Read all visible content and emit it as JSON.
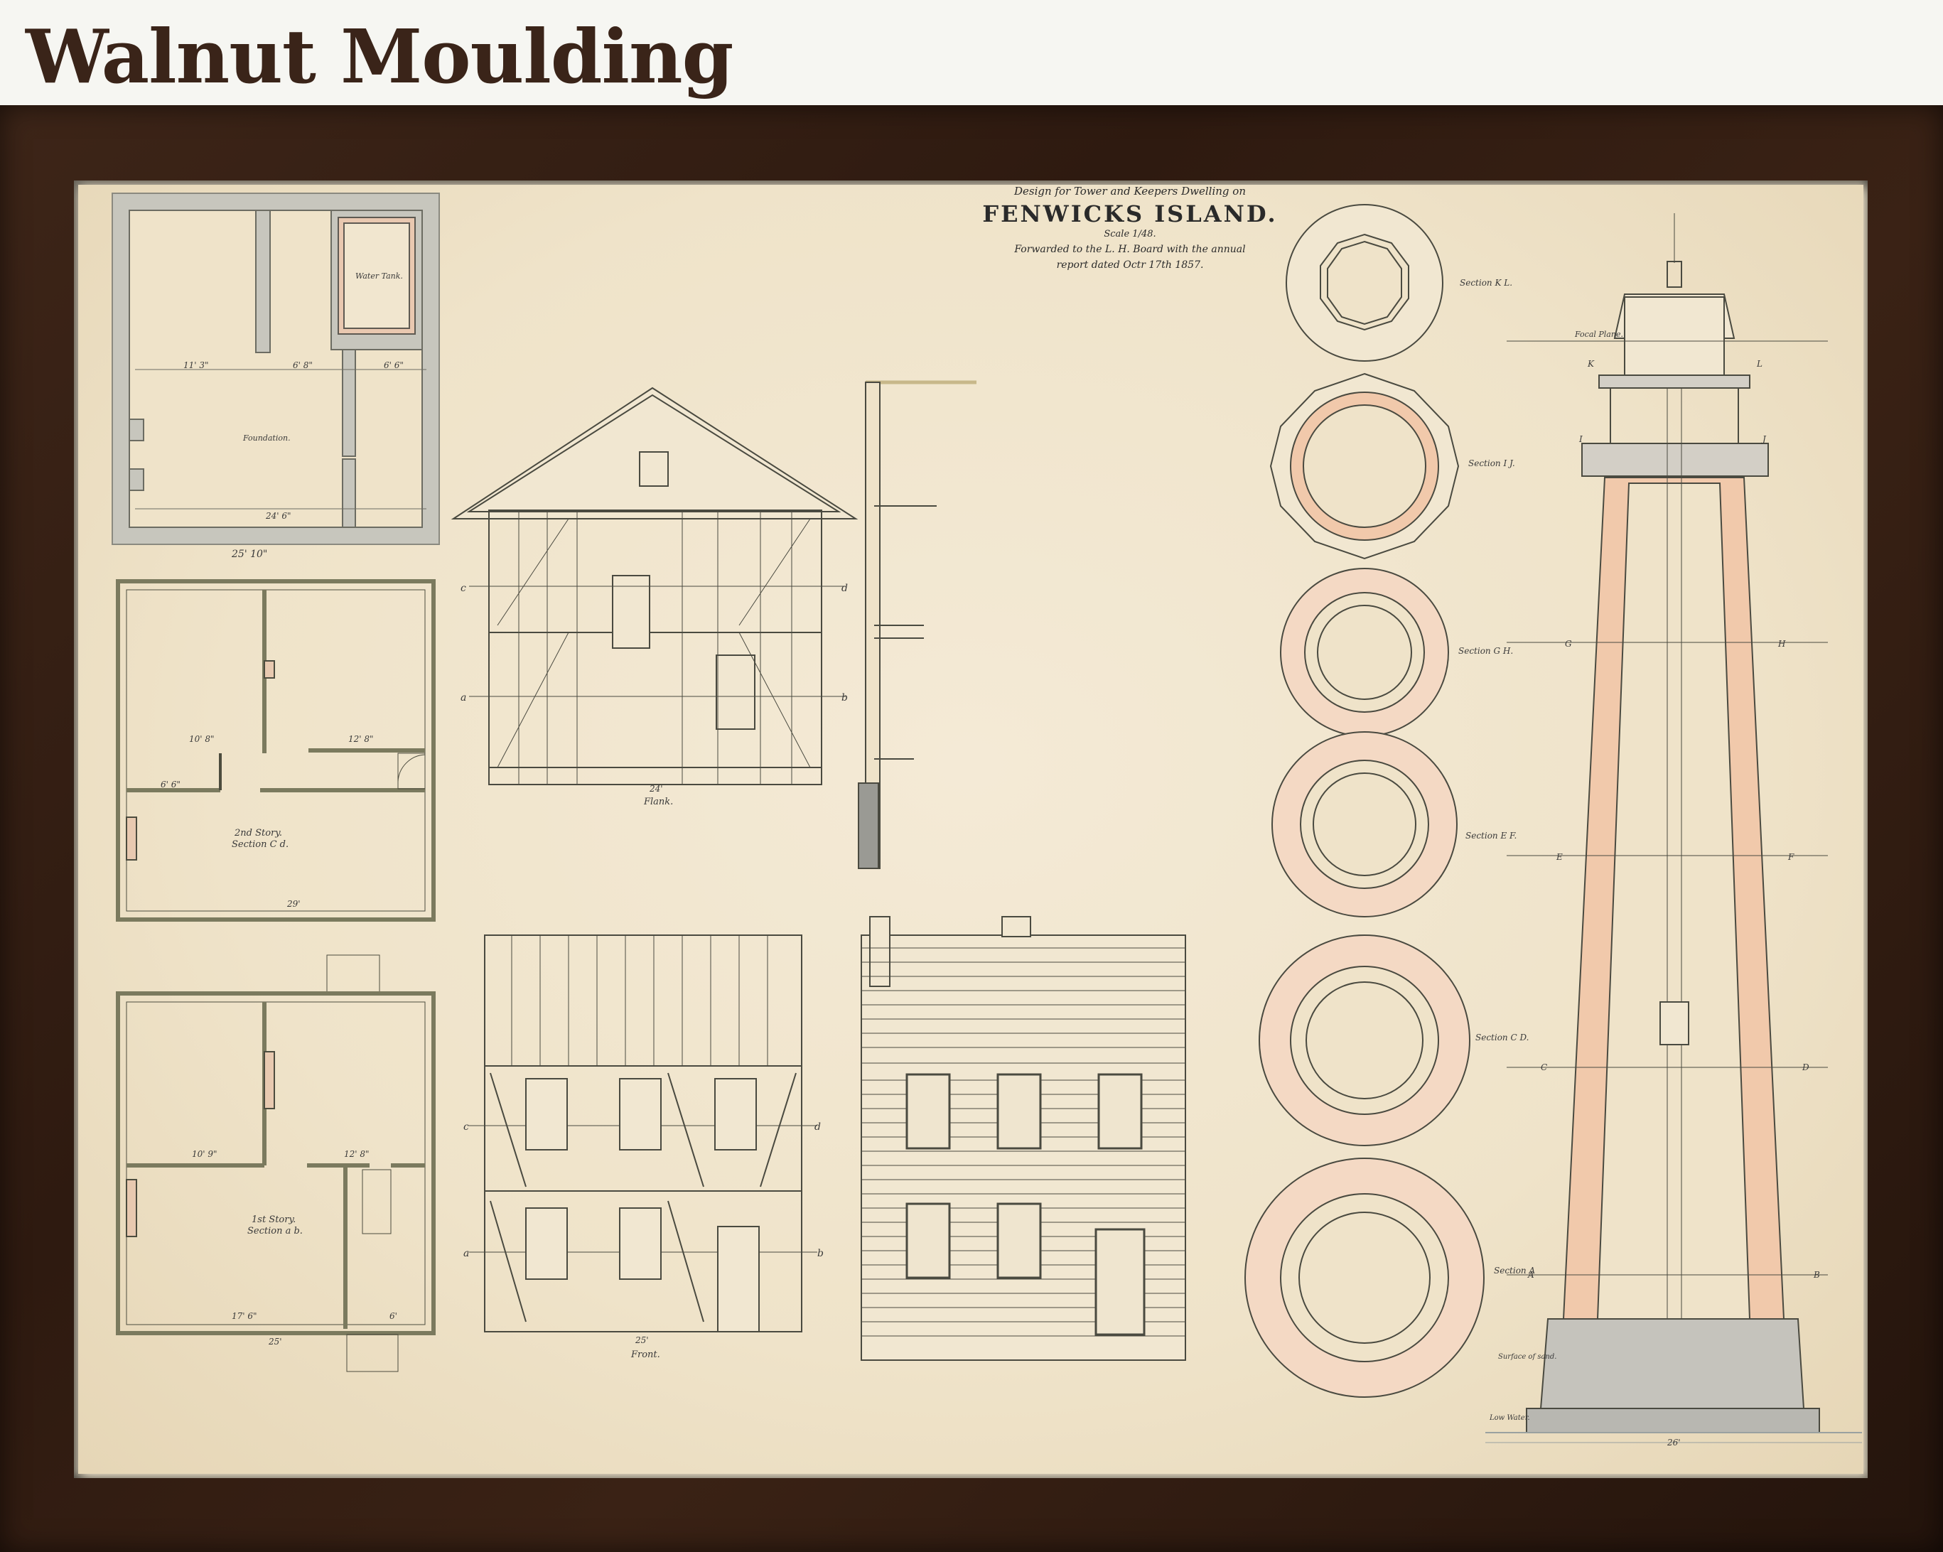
{
  "page": {
    "title": "Walnut Moulding"
  },
  "drawing": {
    "header": {
      "design_line": "Design for Tower and Keepers Dwelling on",
      "place": "FENWICKS ISLAND.",
      "scale": "Scale 1/48.",
      "forwarded_line1": "Forwarded to the L. H. Board with the annual",
      "forwarded_line2": "report dated Octr 17th 1857."
    },
    "labels": {
      "foundation": "Foundation.",
      "water_tank": "Water Tank.",
      "second_story": "2nd Story.",
      "second_section": "Section C d.",
      "first_story": "1st Story.",
      "first_section": "Section a b.",
      "flank": "Flank.",
      "front": "Front.",
      "section_kl": "Section K L.",
      "section_ij": "Section I J.",
      "section_gh": "Section G H.",
      "section_ef": "Section E F.",
      "section_cd": "Section C D.",
      "section_ab": "Section A",
      "focal_plane": "Focal Plane.",
      "surface_of_sand": "Surface of sand.",
      "low_water": "Low Water."
    },
    "dimensions": {
      "d_11_3": "11' 3\"",
      "d_6_8": "6' 8\"",
      "d_6_6": "6' 6\"",
      "d_24_6": "24' 6\"",
      "d_25_10": "25' 10\"",
      "d_10_8": "10' 8\"",
      "d_12_8": "12' 8\"",
      "d_6_6b": "6' 6\"",
      "d_29": "29'",
      "d_10_9": "10' 9\"",
      "d_12_8b": "12' 8\"",
      "d_17_6": "17' 6\"",
      "d_6": "6'",
      "d_25": "25'",
      "d_24": "24'",
      "d_25b": "25'",
      "d_26": "26'"
    },
    "cut_letters": {
      "c": "c",
      "d": "d",
      "a": "a",
      "b": "b",
      "K": "K",
      "L": "L",
      "I": "I",
      "J": "J",
      "G": "G",
      "H": "H",
      "E": "E",
      "F": "F",
      "C": "C",
      "D": "D",
      "A": "A",
      "B": "B"
    }
  }
}
